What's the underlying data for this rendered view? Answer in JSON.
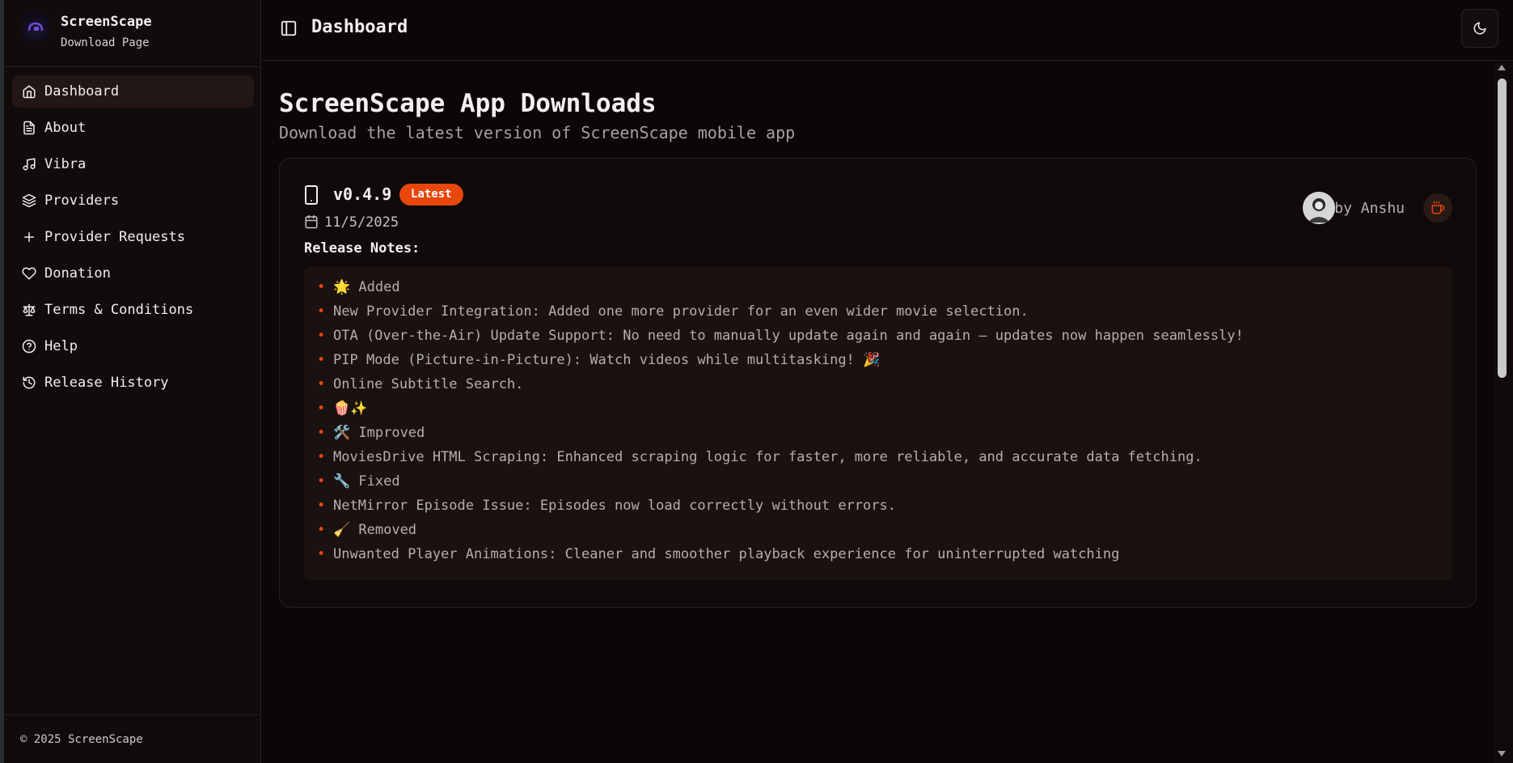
{
  "brand": {
    "name": "ScreenScape",
    "subtitle": "Download Page"
  },
  "sidebar": {
    "items": [
      {
        "label": "Dashboard",
        "icon": "home-icon",
        "active": true
      },
      {
        "label": "About",
        "icon": "file-text-icon"
      },
      {
        "label": "Vibra",
        "icon": "music-icon"
      },
      {
        "label": "Providers",
        "icon": "layers-icon"
      },
      {
        "label": "Provider Requests",
        "icon": "plus-icon"
      },
      {
        "label": "Donation",
        "icon": "heart-icon"
      },
      {
        "label": "Terms & Conditions",
        "icon": "scale-icon"
      },
      {
        "label": "Help",
        "icon": "help-circle-icon"
      },
      {
        "label": "Release History",
        "icon": "history-icon"
      }
    ],
    "footer": "© 2025 ScreenScape"
  },
  "header": {
    "title": "Dashboard"
  },
  "main": {
    "title": "ScreenScape App Downloads",
    "subtitle": "Download the latest version of ScreenScape mobile app",
    "release": {
      "version": "v0.4.9",
      "badge": "Latest",
      "date": "11/5/2025",
      "author": "by Anshu",
      "notes_heading": "Release Notes:",
      "notes": [
        "🌟 Added",
        "New Provider Integration: Added one more provider for an even wider movie selection.",
        "OTA (Over-the-Air) Update Support: No need to manually update again and again — updates now happen seamlessly!",
        "PIP Mode (Picture-in-Picture): Watch videos while multitasking! 🎉",
        "Online Subtitle Search.",
        "🍿✨",
        "🛠️ Improved",
        "MoviesDrive HTML Scraping: Enhanced scraping logic for faster, more reliable, and accurate data fetching.",
        "🔧 Fixed",
        "NetMirror Episode Issue: Episodes now load correctly without errors.",
        "🧹 Removed",
        "Unwanted Player Animations: Cleaner and smoother playback experience for uninterrupted watching"
      ]
    }
  },
  "colors": {
    "accent": "#e8470e",
    "background": "#0b0707",
    "sidebar": "#120b0b"
  }
}
